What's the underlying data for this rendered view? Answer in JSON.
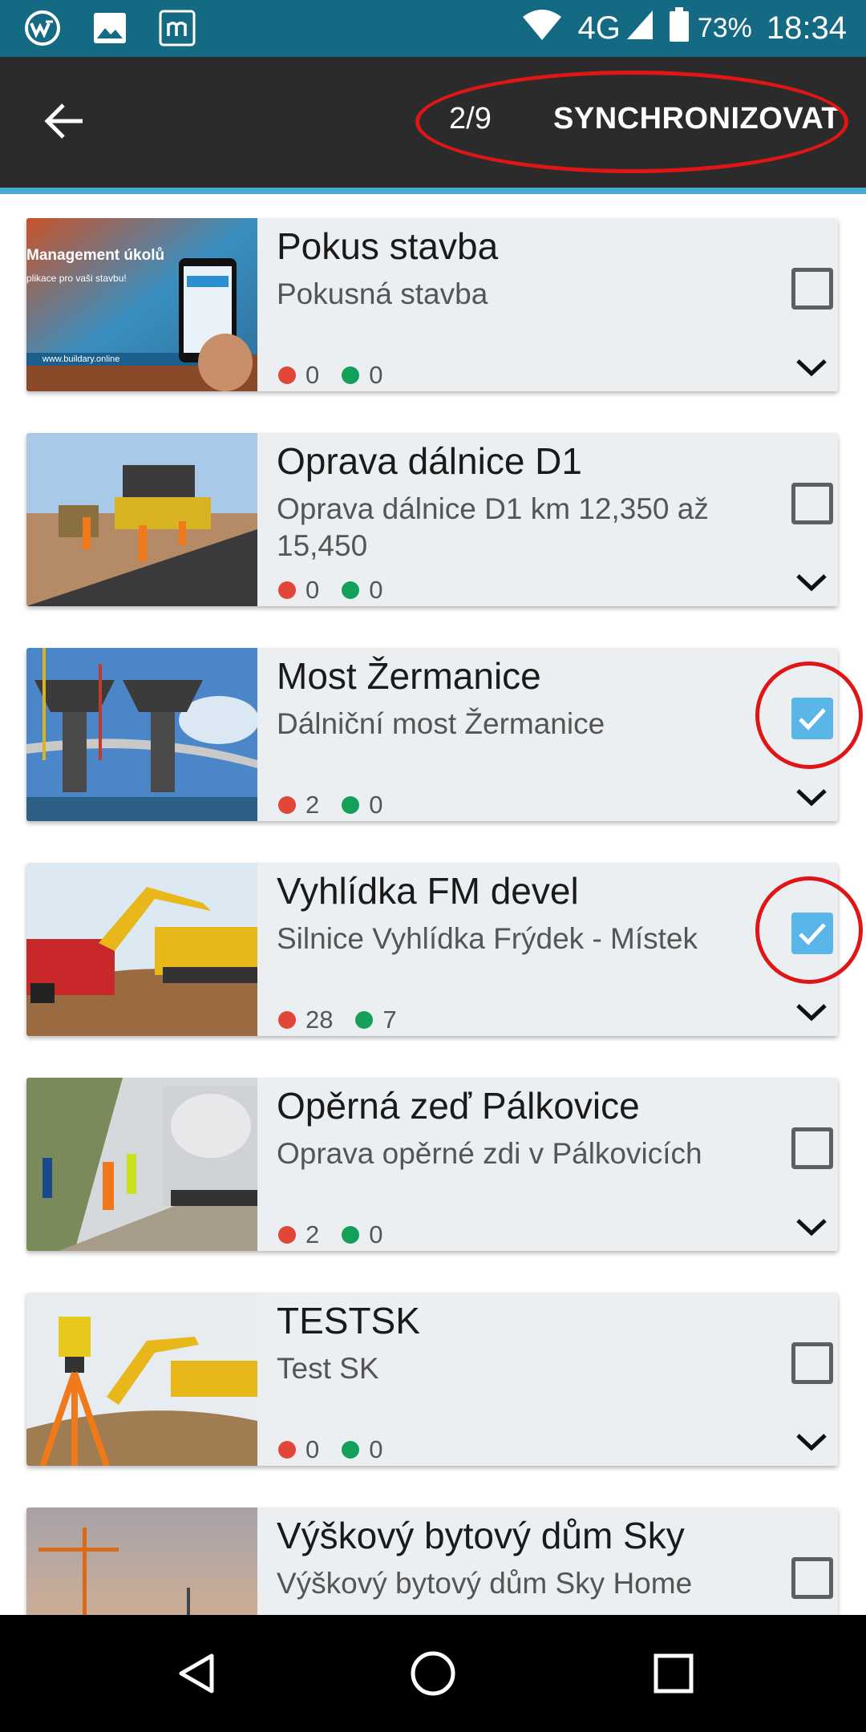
{
  "status_bar": {
    "network": "4G",
    "battery": "73%",
    "time": "18:34",
    "icons": [
      "app-logo-icon",
      "image-icon",
      "messenger-m-icon",
      "wifi-icon",
      "signal-icon",
      "battery-icon"
    ]
  },
  "toolbar": {
    "counter": "2/9",
    "sync_label": "SYNCHRONIZOVAT"
  },
  "projects": [
    {
      "title": "Pokus stavba",
      "subtitle": "Pokusná stavba",
      "red_count": "0",
      "green_count": "0",
      "checked": false,
      "thumb_text_1": "Management úkolů",
      "thumb_text_2": "plikace pro vaši stavbu!",
      "thumb_text_3": "www.buildary.online"
    },
    {
      "title": "Oprava dálnice D1",
      "subtitle": "Oprava dálnice D1 km 12,350 až 15,450",
      "red_count": "0",
      "green_count": "0",
      "checked": false
    },
    {
      "title": "Most Žermanice",
      "subtitle": "Dálniční most Žermanice",
      "red_count": "2",
      "green_count": "0",
      "checked": true
    },
    {
      "title": "Vyhlídka FM devel",
      "subtitle": "Silnice Vyhlídka Frýdek - Místek",
      "red_count": "28",
      "green_count": "7",
      "checked": true
    },
    {
      "title": "Opěrná zeď Pálkovice",
      "subtitle": "Oprava opěrné zdi v Pálkovicích",
      "red_count": "2",
      "green_count": "0",
      "checked": false
    },
    {
      "title": "TESTSK",
      "subtitle": "Test SK",
      "red_count": "0",
      "green_count": "0",
      "checked": false
    },
    {
      "title": "Výškový bytový dům Sky",
      "subtitle": "Výškový bytový dům Sky Home",
      "red_count": "",
      "green_count": "",
      "checked": false
    }
  ],
  "colors": {
    "status_bar": "#136a82",
    "toolbar": "#2b2b2b",
    "accent": "#4aa8d8",
    "checkbox_checked": "#5ab6e8",
    "count_red": "#e0463a",
    "count_green": "#14a05a",
    "annotation_red": "#e01616"
  },
  "nav_bar": {
    "icons": [
      "back-triangle-icon",
      "home-circle-icon",
      "recents-square-icon"
    ]
  }
}
